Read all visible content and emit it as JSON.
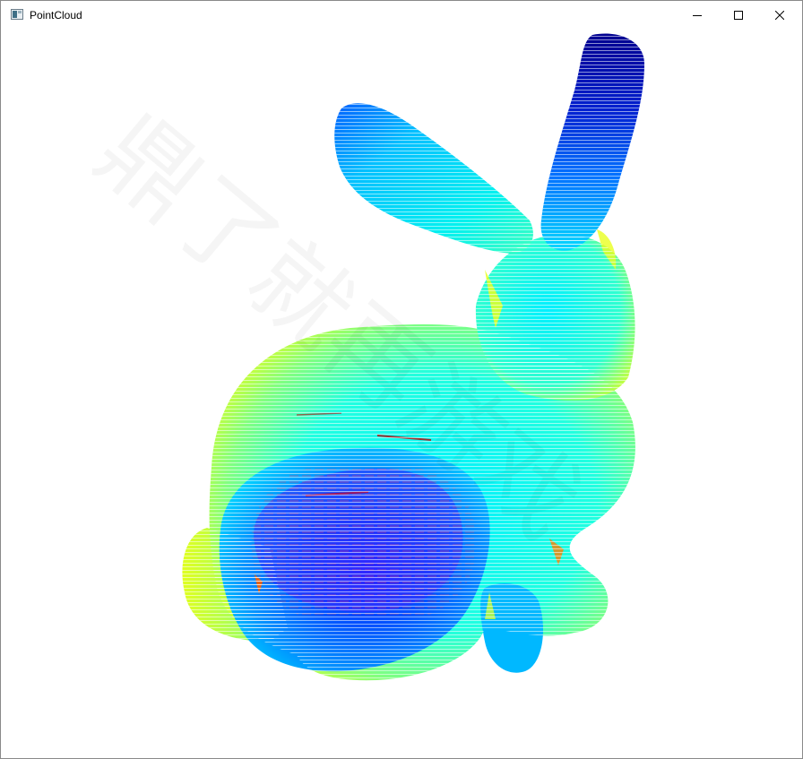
{
  "window": {
    "title": "PointCloud",
    "controls": {
      "minimize_icon": "minimize-icon",
      "maximize_icon": "maximize-icon",
      "close_icon": "close-icon"
    }
  },
  "viewport": {
    "background": "#ffffff",
    "model": "bunny-point-cloud",
    "colormap": [
      "#00008f",
      "#0000ff",
      "#0080ff",
      "#00ffff",
      "#80ff80",
      "#ffff00",
      "#ff8000",
      "#ff0000"
    ],
    "watermark": "鼎了就再游戏"
  }
}
